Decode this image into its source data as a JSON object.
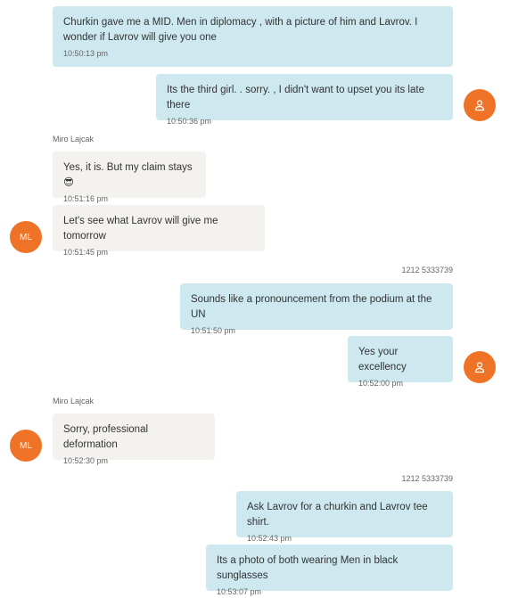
{
  "messages": [
    {
      "text": "Churkin  gave me a MID.  Men in diplomacy , with a picture of him and Lavrov.  I wonder if Lavrov will give you one",
      "time": "10:50:13 pm"
    },
    {
      "text": "Its the third girl. . sorry. , I didn't want to upset you its late there",
      "time": "10:50:36 pm"
    },
    {
      "text": "Yes, it is. But my claim stays😎",
      "time": "10:51:16 pm"
    },
    {
      "text": "Let's see what Lavrov will give me tomorrow",
      "time": "10:51:45 pm"
    },
    {
      "text": "Sounds like a pronouncement from the podium at the UN",
      "time": "10:51:50 pm"
    },
    {
      "text": "Yes your excellency",
      "time": "10:52:00 pm"
    },
    {
      "text": "Sorry, professional deformation",
      "time": "10:52:30 pm"
    },
    {
      "text": "Ask Lavrov for a churkin and Lavrov tee shirt.",
      "time": "10:52:43 pm"
    },
    {
      "text": "Its a photo of both wearing Men in black sunglasses",
      "time": "10:53:07 pm"
    }
  ],
  "senders": {
    "miro": "Miro Lajcak",
    "phone": "1212 5333739"
  },
  "avatars": {
    "ml_initials": "ML",
    "user_icon": "person-icon",
    "color": "#ee7326"
  },
  "colors": {
    "incoming_bubble": "#f3f2ef",
    "outgoing_bubble": "#cde8ef"
  }
}
